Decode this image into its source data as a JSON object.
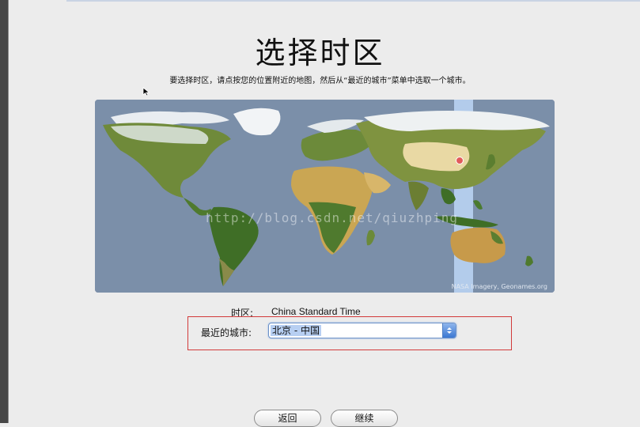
{
  "header": {
    "title": "选择时区",
    "subtitle": "要选择时区，请点按您的位置附近的地图，然后从“最近的城市”菜单中选取一个城市。"
  },
  "map": {
    "credit": "NASA Imagery, Geonames.org",
    "watermark": "http://blog.csdn.net/qiuzhping",
    "ocean_color": "#7b8fa9",
    "selected_zone_color": "#b9d3f2"
  },
  "timezone": {
    "label": "时区:",
    "value": "China Standard Time"
  },
  "closest_city": {
    "label": "最近的城市:",
    "selected": "北京 - 中国"
  },
  "buttons": {
    "back": "返回",
    "continue": "继续"
  }
}
